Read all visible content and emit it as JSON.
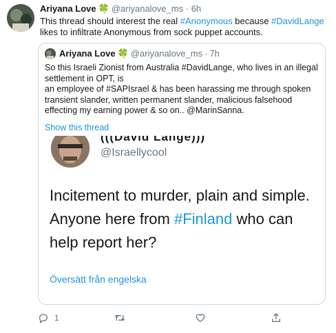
{
  "tweet": {
    "author_name": "Ariyana Love",
    "author_emoji": "🍀",
    "author_handle": "@ariyanalove_ms",
    "separator": "·",
    "time": "6h",
    "text_1": "This thread should interest the real ",
    "hashtag_1": "#Anonymous",
    "text_2": " because ",
    "hashtag_2": "#DavidLange",
    "text_3": " likes to infiltrate Anonymous from sock puppet accounts."
  },
  "quoted": {
    "author_name": "Ariyana Love",
    "author_emoji": "🍀",
    "author_handle": "@ariyanalove_ms",
    "separator": "·",
    "time": "7h",
    "text": "So this Israeli Zionist from Australia #DavidLange, who lives in an illegal settlement in OPT, is\nan employee of #SAPIsrael & has been harassing me through spoken transient slander, written permanent slander, malicious falsehood effecting my earning power & so on.. @MarinSanna.",
    "show_thread": "Show this thread",
    "image": {
      "name": "(((David Lange)))",
      "handle": "@Israellycool",
      "big_text_1": "Incitement to murder, plain and simple. Anyone here from ",
      "big_hashtag": "#Finland",
      "big_text_2": " who can help report her?",
      "translate": "Översätt från engelska"
    }
  },
  "actions": {
    "reply_count": "1",
    "icons": [
      "reply-icon",
      "retweet-icon",
      "like-icon",
      "share-icon"
    ]
  },
  "colors": {
    "link": "#1b95e0",
    "muted": "#657786",
    "border": "#ccd6dd",
    "clover": "#3ea34a"
  }
}
